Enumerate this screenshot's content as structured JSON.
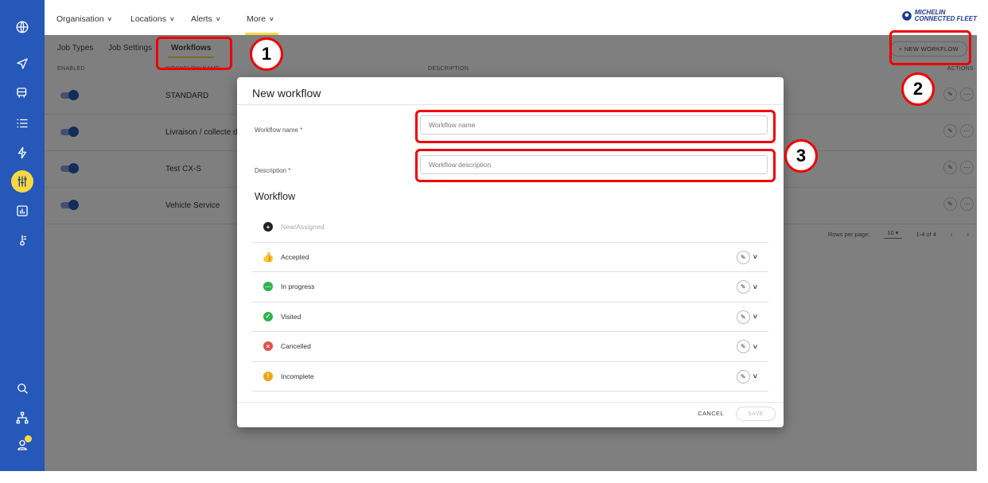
{
  "nav": {
    "items": [
      {
        "label": "Organisation"
      },
      {
        "label": "Locations"
      },
      {
        "label": "Alerts"
      },
      {
        "label": "More"
      }
    ],
    "chevron": "˅",
    "brand_line1": "MICHELIN",
    "brand_line2": "CONNECTED FLEET"
  },
  "sidebar": {
    "icons": [
      "globe-icon",
      "navigation-icon",
      "vehicle-icon",
      "list-icon",
      "lightning-icon",
      "sliders-icon",
      "chart-icon",
      "thermometer-icon",
      "search-icon",
      "network-icon",
      "user-icon"
    ],
    "active": "sliders-icon",
    "user_badge": "0"
  },
  "subtabs": [
    {
      "label": "Job Types"
    },
    {
      "label": "Job Settings"
    },
    {
      "label": "Workflows"
    }
  ],
  "new_workflow_button": "+ NEW WORKFLOW",
  "table": {
    "headers": {
      "enabled": "ENABLED",
      "name": "WORKFLOW NAME",
      "description": "DESCRIPTION",
      "actions": "ACTIONS"
    },
    "rows": [
      {
        "name": "STANDARD"
      },
      {
        "name": "Livraison / collecte de"
      },
      {
        "name": "Test CX-S"
      },
      {
        "name": "Vehicle Service"
      }
    ],
    "rows_per_page_label": "Rows per page:",
    "rows_per_page_value": "10",
    "page_range": "1-4 of 4"
  },
  "modal": {
    "title": "New workflow",
    "name_label": "Workflow name *",
    "name_placeholder": "Workflow name",
    "desc_label": "Description *",
    "desc_placeholder": "Workflow description",
    "workflow_heading": "Workflow",
    "statuses": [
      {
        "label": "New/Assigned",
        "icon": "plus-circle-icon",
        "color": "#222222",
        "muted": true
      },
      {
        "label": "Accepted",
        "icon": "thumbs-up-icon",
        "color": "#3aa64b"
      },
      {
        "label": "In progress",
        "icon": "more-circle-icon",
        "color": "#2eb24a"
      },
      {
        "label": "Visited",
        "icon": "check-circle-icon",
        "color": "#2eb24a"
      },
      {
        "label": "Cancelled",
        "icon": "x-circle-icon",
        "color": "#e2504c"
      },
      {
        "label": "Incomplete",
        "icon": "alert-circle-icon",
        "color": "#f2a516"
      }
    ],
    "cancel_label": "CANCEL",
    "save_label": "SAVE"
  },
  "annotations": {
    "callouts": [
      "1",
      "2",
      "3"
    ],
    "color": "#e00000"
  }
}
